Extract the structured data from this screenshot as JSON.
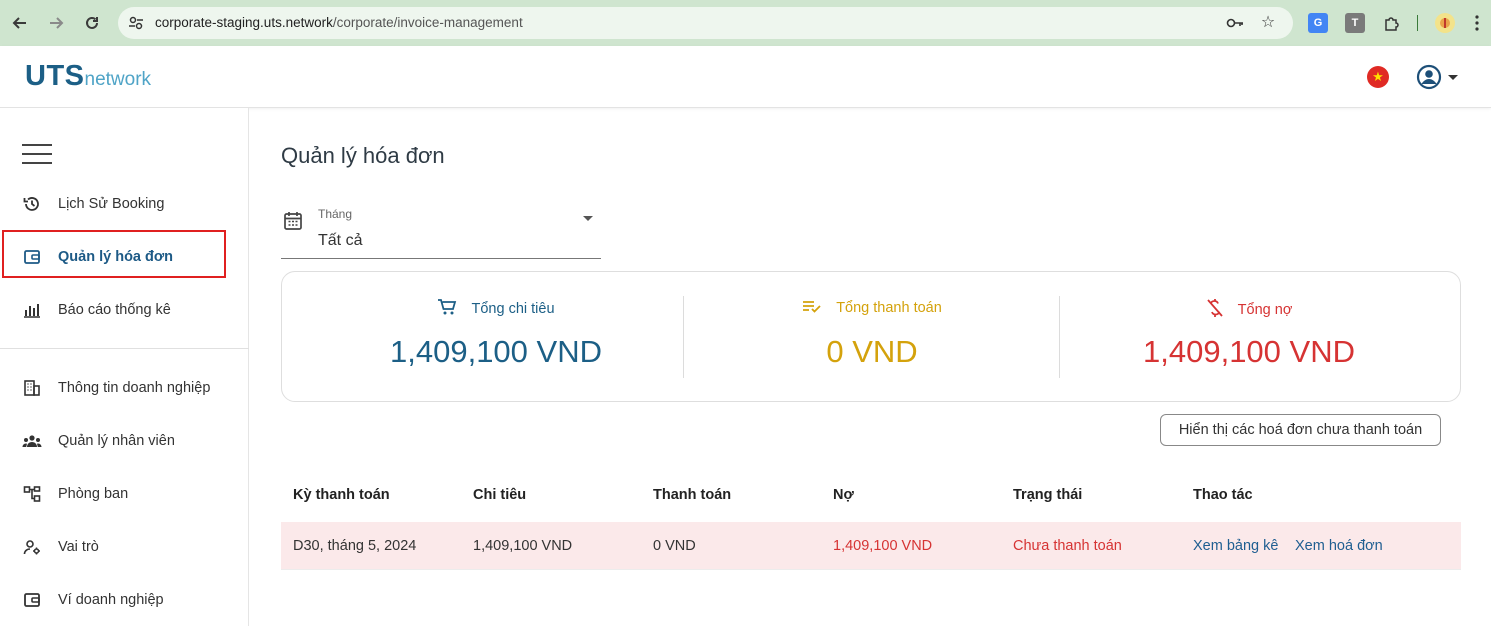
{
  "browser": {
    "url_host": "corporate-staging.uts.network",
    "url_path": "/corporate/invoice-management",
    "extensions": [
      {
        "icon": "translate-extension-icon"
      },
      {
        "icon": "t-extension-icon",
        "label": "T"
      },
      {
        "icon": "puzzle-extensions-icon"
      },
      {
        "icon": "profile-avatar-icon"
      }
    ]
  },
  "header": {
    "logo_main": "UTS",
    "logo_sub": "network",
    "language_flag": "vietnam-flag-icon",
    "account_icon": "account-circle-icon"
  },
  "sidebar": {
    "items": [
      {
        "label": "Lịch Sử Booking",
        "icon": "history-icon"
      },
      {
        "label": "Quản lý hóa đơn",
        "icon": "wallet-icon",
        "active": true
      },
      {
        "label": "Báo cáo thống kê",
        "icon": "bar-chart-icon"
      },
      {
        "label": "Thông tin doanh nghiệp",
        "icon": "building-icon"
      },
      {
        "label": "Quản lý nhân viên",
        "icon": "people-icon"
      },
      {
        "label": "Phòng ban",
        "icon": "org-chart-icon"
      },
      {
        "label": "Vai trò",
        "icon": "user-settings-icon"
      },
      {
        "label": "Ví doanh nghiệp",
        "icon": "wallet-icon"
      }
    ]
  },
  "main": {
    "title": "Quản lý hóa đơn",
    "filter": {
      "label": "Tháng",
      "value": "Tất cả"
    },
    "summary": [
      {
        "label": "Tổng chi tiêu",
        "value": "1,409,100 VND",
        "color": "#1c5f86",
        "icon": "cart-icon"
      },
      {
        "label": "Tổng thanh toán",
        "value": "0 VND",
        "color": "#d4a20c",
        "icon": "checklist-icon"
      },
      {
        "label": "Tổng nợ",
        "value": "1,409,100 VND",
        "color": "#d63333",
        "icon": "money-off-icon"
      }
    ],
    "unpaid_button": "Hiển thị các hoá đơn chưa thanh toán",
    "table": {
      "headers": [
        "Kỳ thanh toán",
        "Chi tiêu",
        "Thanh toán",
        "Nợ",
        "Trạng thái",
        "Thao tác"
      ],
      "rows": [
        {
          "period": "D30, tháng 5, 2024",
          "spend": "1,409,100 VND",
          "paid": "0 VND",
          "debt": "1,409,100 VND",
          "status": "Chưa thanh toán",
          "action_1": "Xem bảng kê",
          "action_2": "Xem hoá đơn"
        }
      ]
    }
  }
}
